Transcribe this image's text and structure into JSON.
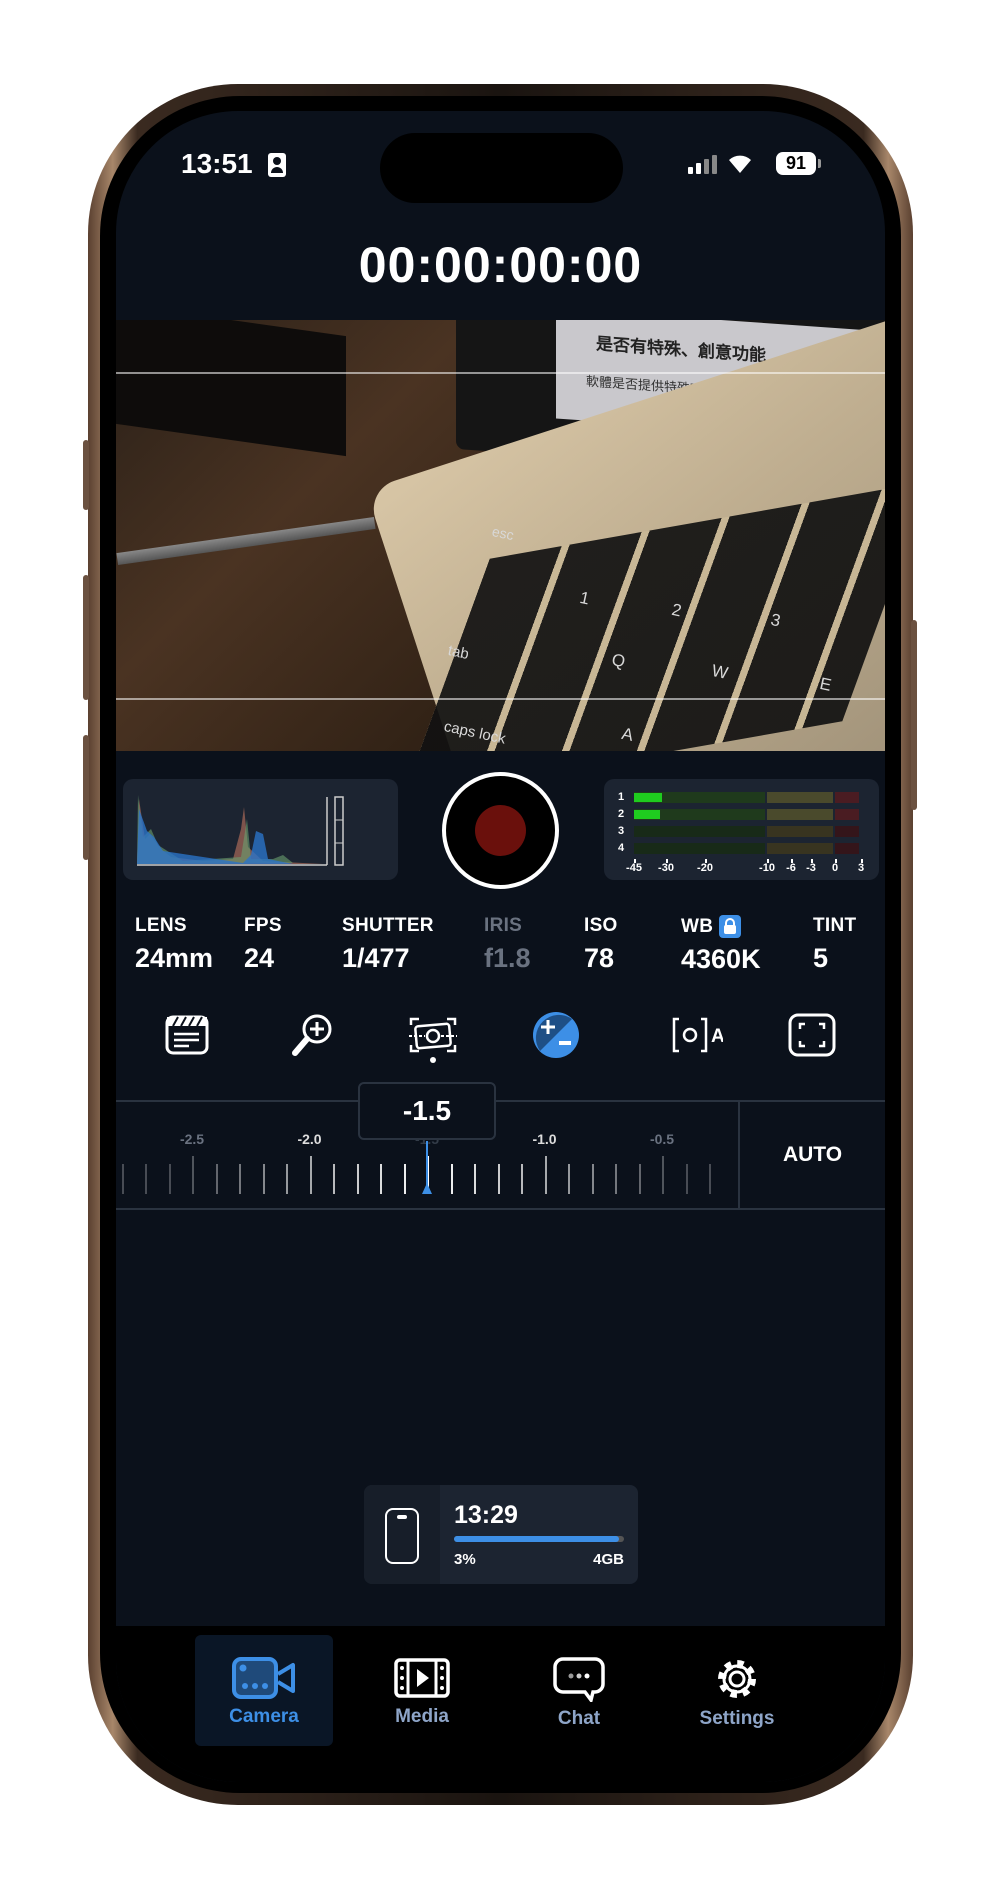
{
  "status_bar": {
    "time": "13:51",
    "battery": "91"
  },
  "timecode": "00:00:00:00",
  "preview": {
    "overlay_heading": "是否有特殊、創意功能",
    "overlay_text": "軟體是否提供特殊功能如多鏡頭錄影、色彩",
    "key_labels": [
      "esc",
      "1",
      "2",
      "3",
      "tab",
      "Q",
      "W",
      "E",
      "caps lock",
      "A"
    ]
  },
  "audio_meter": {
    "channels": [
      "1",
      "2",
      "3",
      "4"
    ],
    "levels_db": [
      -32,
      -33,
      null,
      null
    ],
    "scale": [
      "-45",
      "-30",
      "-20",
      "-10",
      "-6",
      "-3",
      "0",
      "3"
    ]
  },
  "record_button": {
    "state": "idle"
  },
  "params": [
    {
      "label": "LENS",
      "value": "24mm"
    },
    {
      "label": "FPS",
      "value": "24"
    },
    {
      "label": "SHUTTER",
      "value": "1/477"
    },
    {
      "label": "IRIS",
      "value": "f1.8",
      "disabled": true
    },
    {
      "label": "ISO",
      "value": "78"
    },
    {
      "label": "WB",
      "value": "4360K",
      "locked": true
    },
    {
      "label": "TINT",
      "value": "5"
    }
  ],
  "tools": [
    "clapper-icon",
    "zoom-in-icon",
    "camera-stabilize-icon",
    "exposure-compensation-icon",
    "auto-focus-icon",
    "frame-guide-icon"
  ],
  "exposure": {
    "value": "-1.5",
    "current": -1.5,
    "auto_label": "AUTO",
    "ticks": [
      "-2.5",
      "-2.0",
      "-1.5",
      "-1.0",
      "-0.5"
    ]
  },
  "storage": {
    "time_remaining": "13:29",
    "percent_label": "3%",
    "used_fraction": 0.97,
    "capacity": "4GB"
  },
  "tabs": [
    {
      "label": "Camera",
      "active": true
    },
    {
      "label": "Media"
    },
    {
      "label": "Chat"
    },
    {
      "label": "Settings"
    }
  ],
  "colors": {
    "accent": "#3d8fe6",
    "record": "#6a100c",
    "meter_green": "#1fcc1f"
  }
}
